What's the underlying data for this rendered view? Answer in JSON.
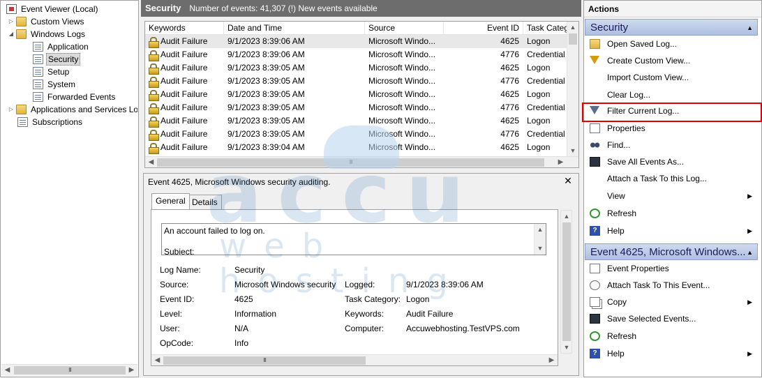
{
  "tree": {
    "root": "Event Viewer (Local)",
    "custom_views": "Custom Views",
    "windows_logs": "Windows Logs",
    "logs": [
      "Application",
      "Security",
      "Setup",
      "System",
      "Forwarded Events"
    ],
    "apps_services": "Applications and Services Lo",
    "subscriptions": "Subscriptions"
  },
  "center": {
    "log_name": "Security",
    "event_info": "Number of events: 41,307 (!) New events available"
  },
  "table": {
    "columns": [
      "Keywords",
      "Date and Time",
      "Source",
      "Event ID",
      "Task Categ"
    ],
    "rows": [
      {
        "keywords": "Audit Failure",
        "date": "9/1/2023 8:39:06 AM",
        "source": "Microsoft Windo...",
        "id": "4625",
        "task": "Logon"
      },
      {
        "keywords": "Audit Failure",
        "date": "9/1/2023 8:39:06 AM",
        "source": "Microsoft Windo...",
        "id": "4776",
        "task": "Credential"
      },
      {
        "keywords": "Audit Failure",
        "date": "9/1/2023 8:39:05 AM",
        "source": "Microsoft Windo...",
        "id": "4625",
        "task": "Logon"
      },
      {
        "keywords": "Audit Failure",
        "date": "9/1/2023 8:39:05 AM",
        "source": "Microsoft Windo...",
        "id": "4776",
        "task": "Credential"
      },
      {
        "keywords": "Audit Failure",
        "date": "9/1/2023 8:39:05 AM",
        "source": "Microsoft Windo...",
        "id": "4625",
        "task": "Logon"
      },
      {
        "keywords": "Audit Failure",
        "date": "9/1/2023 8:39:05 AM",
        "source": "Microsoft Windo...",
        "id": "4776",
        "task": "Credential"
      },
      {
        "keywords": "Audit Failure",
        "date": "9/1/2023 8:39:05 AM",
        "source": "Microsoft Windo...",
        "id": "4625",
        "task": "Logon"
      },
      {
        "keywords": "Audit Failure",
        "date": "9/1/2023 8:39:05 AM",
        "source": "Microsoft Windo...",
        "id": "4776",
        "task": "Credential"
      },
      {
        "keywords": "Audit Failure",
        "date": "9/1/2023 8:39:04 AM",
        "source": "Microsoft Windo...",
        "id": "4625",
        "task": "Logon"
      }
    ]
  },
  "detail": {
    "title": "Event 4625, Microsoft Windows security auditing.",
    "tabs": [
      "General",
      "Details"
    ],
    "description_line1": "An account failed to log on.",
    "description_line2": "Subject:",
    "log_name_label": "Log Name:",
    "log_name": "Security",
    "source_label": "Source:",
    "source": "Microsoft Windows security",
    "logged_label": "Logged:",
    "logged": "9/1/2023 8:39:06 AM",
    "event_id_label": "Event ID:",
    "event_id": "4625",
    "task_category_label": "Task Category:",
    "task_category": "Logon",
    "level_label": "Level:",
    "level": "Information",
    "keywords_label": "Keywords:",
    "keywords": "Audit Failure",
    "user_label": "User:",
    "user": "N/A",
    "computer_label": "Computer:",
    "computer": "Accuwebhosting.TestVPS.com",
    "opcode_label": "OpCode:",
    "opcode": "Info"
  },
  "actions": {
    "title": "Actions",
    "group1": "Security",
    "items1": [
      "Open Saved Log...",
      "Create Custom View...",
      "Import Custom View...",
      "Clear Log...",
      "Filter Current Log...",
      "Properties",
      "Find...",
      "Save All Events As...",
      "Attach a Task To this Log...",
      "View",
      "Refresh",
      "Help"
    ],
    "group2": "Event 4625, Microsoft Windows...",
    "items2": [
      "Event Properties",
      "Attach Task To This Event...",
      "Copy",
      "Save Selected Events...",
      "Refresh",
      "Help"
    ]
  },
  "watermark": {
    "brand": "accu",
    "tagline": "web hosting"
  },
  "colors": {
    "highlight_border": "#e00000",
    "header_bg": "#6d6d6d",
    "group_header": "#b9c8e6"
  }
}
